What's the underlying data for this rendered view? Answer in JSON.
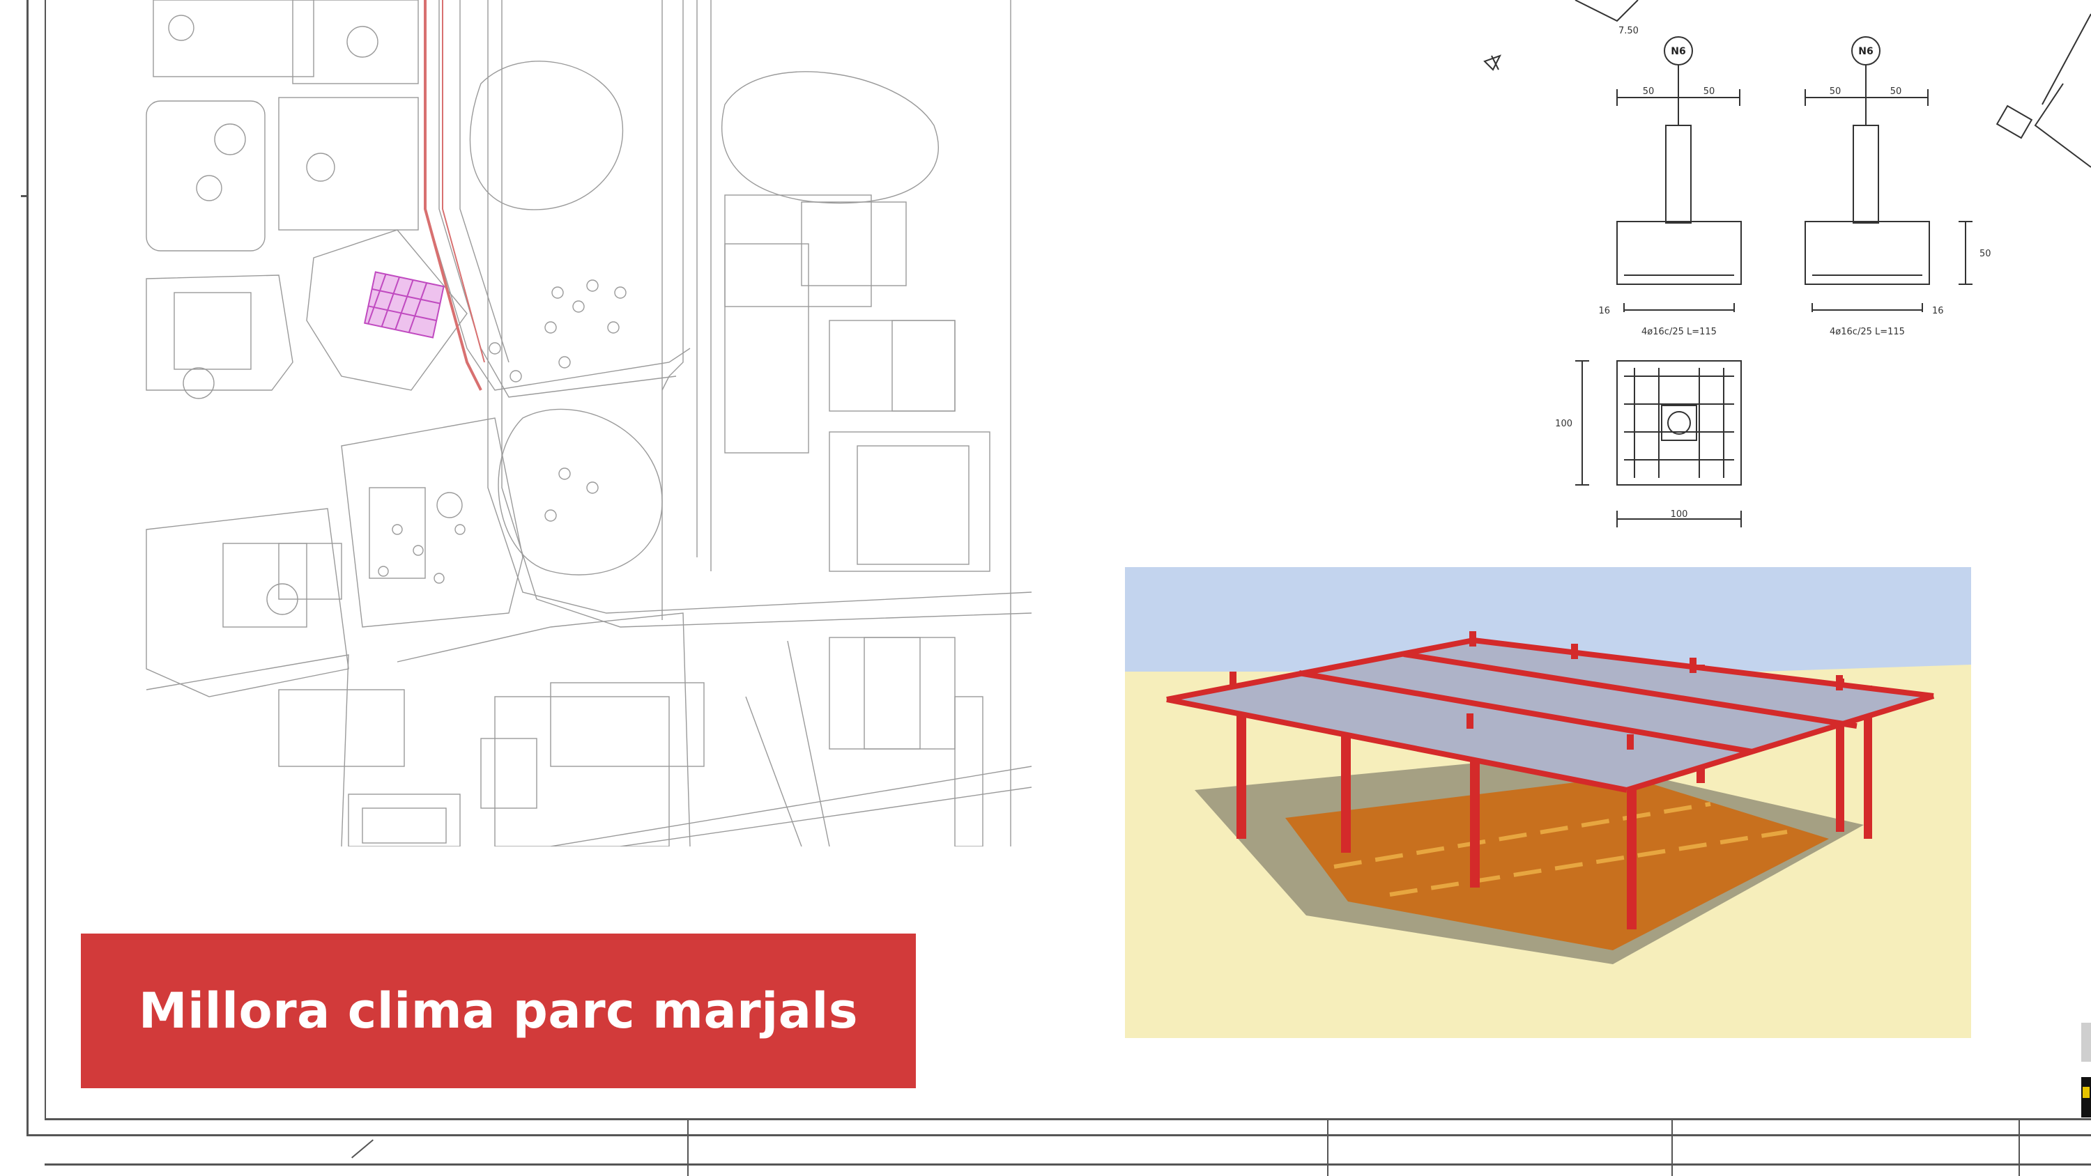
{
  "title": "Millora clima parc marjals",
  "detail_labels": {
    "bubble_left": "N6",
    "bubble_right": "N6",
    "dim_50_a": "50",
    "dim_50_b": "50",
    "dim_50_c": "50",
    "dim_50_d": "50",
    "dim_height": "50",
    "dim_16_left": "16",
    "dim_16_right": "16",
    "rebar_left": "4ø16c/25 L=115",
    "rebar_right": "4ø16c/25 L=115",
    "plan_dim_side": "100",
    "plan_dim_bottom": "100",
    "top_dim": "7.50"
  },
  "colors": {
    "title_bg": "#d23a3a",
    "title_text": "#ffffff",
    "highlight": "#c04ac0",
    "steel": "#d42a2a",
    "roof": "#aeb3c8",
    "sky": "#c3d4ee",
    "ground": "#f6eebb",
    "floor": "#c8701e"
  }
}
